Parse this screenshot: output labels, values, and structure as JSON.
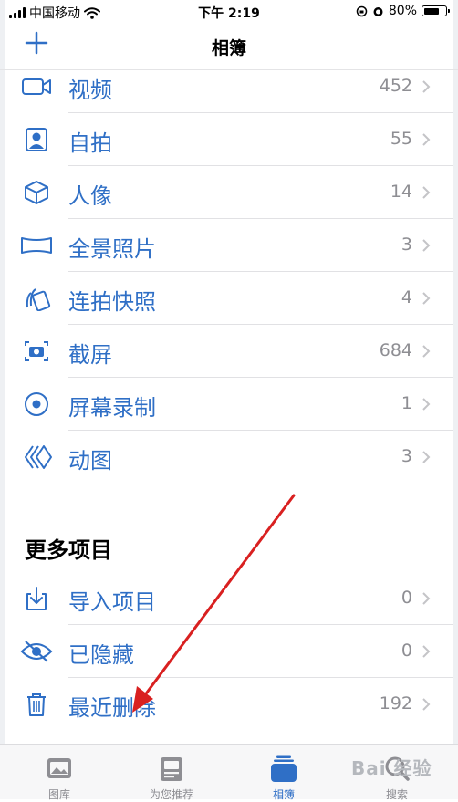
{
  "status_bar": {
    "carrier": "中国移动",
    "time": "下午 2:19",
    "battery": "80%",
    "battery_level": 0.8
  },
  "nav": {
    "title": "相簿",
    "add_icon": "plus-icon"
  },
  "media_types": [
    {
      "label": "视频",
      "count": "452",
      "icon": "video-icon"
    },
    {
      "label": "自拍",
      "count": "55",
      "icon": "selfie-icon"
    },
    {
      "label": "人像",
      "count": "14",
      "icon": "portrait-cube-icon"
    },
    {
      "label": "全景照片",
      "count": "3",
      "icon": "panorama-icon"
    },
    {
      "label": "连拍快照",
      "count": "4",
      "icon": "burst-icon"
    },
    {
      "label": "截屏",
      "count": "684",
      "icon": "screenshot-icon"
    },
    {
      "label": "屏幕录制",
      "count": "1",
      "icon": "screen-recording-icon"
    },
    {
      "label": "动图",
      "count": "3",
      "icon": "animated-icon"
    }
  ],
  "more_items": {
    "title": "更多项目",
    "items": [
      {
        "label": "导入项目",
        "count": "0",
        "icon": "import-icon"
      },
      {
        "label": "已隐藏",
        "count": "0",
        "icon": "hidden-eye-icon"
      },
      {
        "label": "最近删除",
        "count": "192",
        "icon": "trash-icon"
      }
    ]
  },
  "tab_bar": {
    "tabs": [
      {
        "label": "图库",
        "icon": "library-icon",
        "active": false
      },
      {
        "label": "为您推荐",
        "icon": "for-you-icon",
        "active": false
      },
      {
        "label": "相簿",
        "icon": "albums-icon",
        "active": true
      },
      {
        "label": "搜索",
        "icon": "search-icon",
        "active": false
      }
    ]
  },
  "colors": {
    "accent": "#2f6fc6",
    "count_gray": "#8e8e93",
    "annotation_arrow": "#d92020"
  },
  "watermark": "Bai 经验"
}
